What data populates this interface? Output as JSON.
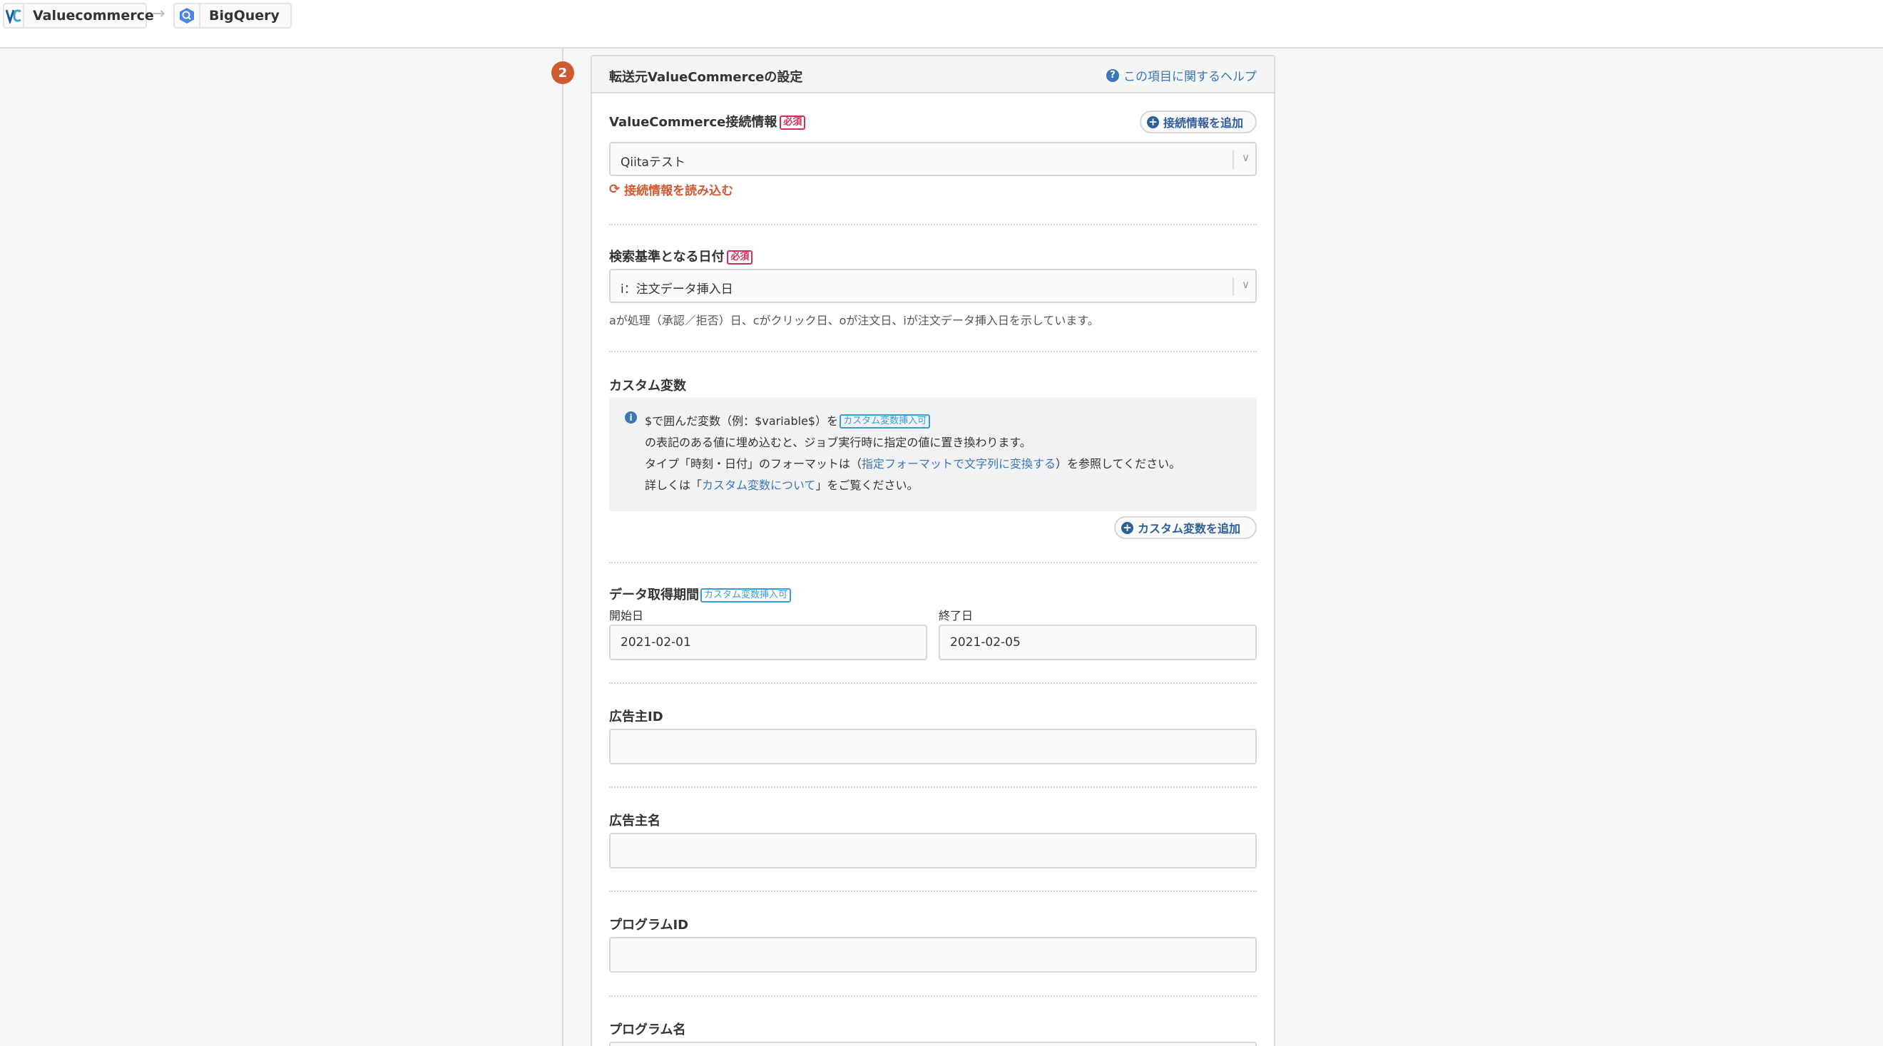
{
  "breadcrumb": {
    "source": {
      "name": "Valuecommerce",
      "logo_text": "VC"
    },
    "arrow": "→",
    "destination": {
      "name": "BigQuery"
    }
  },
  "step": {
    "number": "2"
  },
  "card": {
    "title": "転送元ValueCommerceの設定",
    "help_link": "この項目に関するヘルプ"
  },
  "connection": {
    "label": "ValueCommerce接続情報",
    "required": "必須",
    "add_button": "接続情報を追加",
    "selected": "Qiitaテスト",
    "reload_link": "接続情報を読み込む"
  },
  "search_date": {
    "label": "検索基準となる日付",
    "required": "必須",
    "selected": "i：注文データ挿入日",
    "help": "aが処理（承認／拒否）日、cがクリック日、oが注文日、iが注文データ挿入日を示しています。"
  },
  "custom_vars": {
    "label": "カスタム変数",
    "line1_a": "$で囲んだ変数（例：$variable$）を",
    "line1_tag": "カスタム変数挿入可",
    "line2": "の表記のある値に埋め込むと、ジョブ実行時に指定の値に置き換わります。",
    "line3_a": "タイプ「時刻・日付」のフォーマットは（",
    "line3_link": "指定フォーマットで文字列に変換する",
    "line3_b": "）を参照してください。",
    "line4_a": "詳しくは「",
    "line4_link": "カスタム変数について",
    "line4_b": "」をご覧ください。",
    "add_button": "カスタム変数を追加"
  },
  "period": {
    "label": "データ取得期間",
    "tag": "カスタム変数挿入可",
    "start_label": "開始日",
    "start_value": "2021-02-01",
    "end_label": "終了日",
    "end_value": "2021-02-05"
  },
  "advertiser_id": {
    "label": "広告主ID",
    "value": ""
  },
  "advertiser_name": {
    "label": "広告主名",
    "value": ""
  },
  "program_id": {
    "label": "プログラムID",
    "value": ""
  },
  "program_name": {
    "label": "プログラム名",
    "value": ""
  }
}
